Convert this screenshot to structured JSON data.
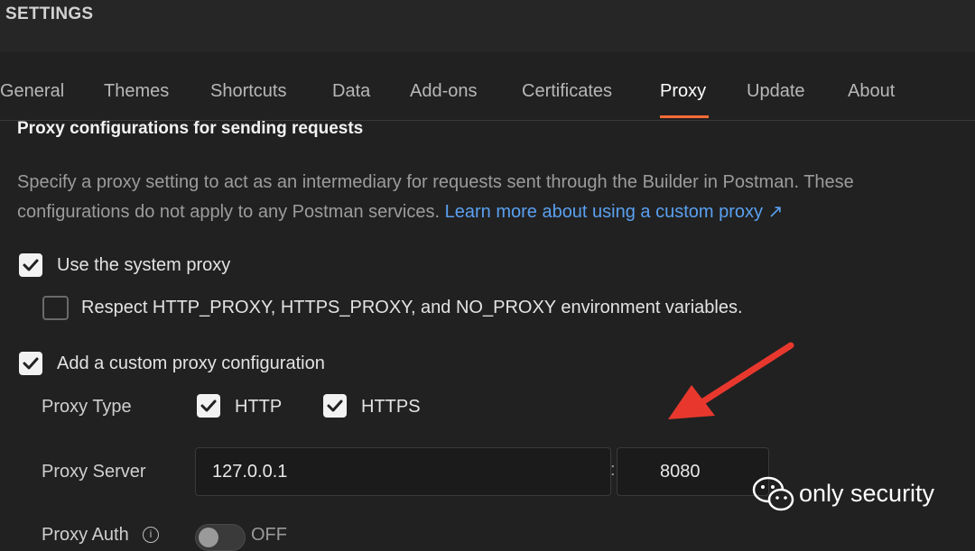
{
  "header": {
    "title": "SETTINGS"
  },
  "tabs": [
    {
      "label": "General"
    },
    {
      "label": "Themes"
    },
    {
      "label": "Shortcuts"
    },
    {
      "label": "Data"
    },
    {
      "label": "Add-ons"
    },
    {
      "label": "Certificates"
    },
    {
      "label": "Proxy",
      "active": true
    },
    {
      "label": "Update"
    },
    {
      "label": "About"
    }
  ],
  "accent_color": "#ff6c37",
  "section": {
    "title": "Proxy configurations for sending requests",
    "description_line1": "Specify a proxy setting to act as an intermediary for requests sent through the Builder in Postman. These",
    "description_line2": "configurations do not apply to any Postman services.",
    "link_text": "Learn more about using a custom proxy ↗"
  },
  "options": {
    "system_proxy": {
      "label": "Use the system proxy",
      "checked": true
    },
    "env_vars": {
      "label": "Respect HTTP_PROXY, HTTPS_PROXY, and NO_PROXY environment variables.",
      "checked": false
    },
    "custom_proxy": {
      "label": "Add a custom proxy configuration",
      "checked": true
    }
  },
  "proxy_type": {
    "label": "Proxy Type",
    "http": {
      "label": "HTTP",
      "checked": true
    },
    "https": {
      "label": "HTTPS",
      "checked": true
    }
  },
  "proxy_server": {
    "label": "Proxy Server",
    "host": "127.0.0.1",
    "separator": ":",
    "port": "8080"
  },
  "proxy_auth": {
    "label": "Proxy Auth",
    "state": "OFF",
    "info_icon": "i"
  },
  "annotation": {
    "arrow_color": "#e8382e"
  },
  "watermark": {
    "text": "only security",
    "icon": "wechat-icon"
  }
}
